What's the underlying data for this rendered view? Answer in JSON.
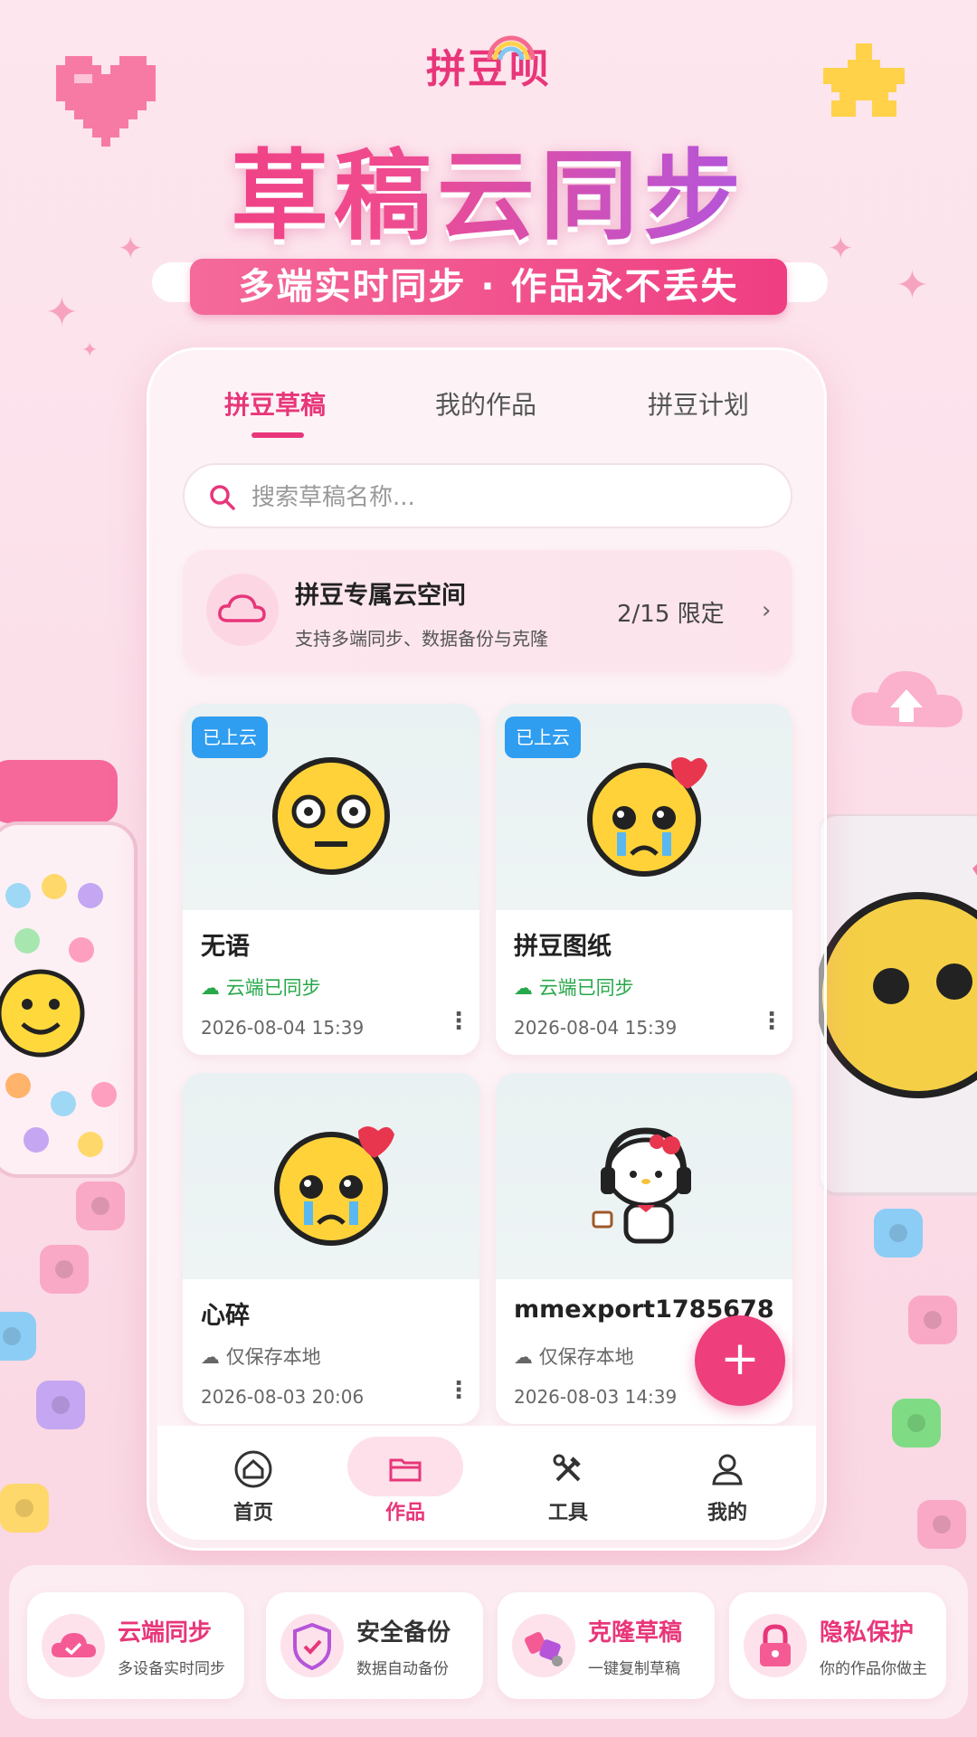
{
  "brand": "拼豆呗",
  "hero": {
    "title": "草稿云同步",
    "subtitle": "多端实时同步 · 作品永不丢失"
  },
  "tabs": [
    {
      "label": "拼豆草稿",
      "active": true
    },
    {
      "label": "我的作品",
      "active": false
    },
    {
      "label": "拼豆计划",
      "active": false
    }
  ],
  "search": {
    "placeholder": "搜索草稿名称..."
  },
  "cloud_space": {
    "title": "拼豆专属云空间",
    "description": "支持多端同步、数据备份与克隆",
    "quota": "2/15 限定",
    "chevron": "›"
  },
  "drafts": [
    {
      "name": "无语",
      "badge": "已上云",
      "status": "云端已同步",
      "synced": true,
      "date": "2026-08-04 15:39",
      "image": "speechless-face-icon"
    },
    {
      "name": "拼豆图纸",
      "badge": "已上云",
      "status": "云端已同步",
      "synced": true,
      "date": "2026-08-04 15:39",
      "image": "crying-heartbroken-face-icon"
    },
    {
      "name": "心碎",
      "badge": "",
      "status": "仅保存本地",
      "synced": false,
      "date": "2026-08-03 20:06",
      "image": "crying-heartbroken-face-icon"
    },
    {
      "name": "mmexport1785678...",
      "badge": "",
      "status": "仅保存本地",
      "synced": false,
      "date": "2026-08-03 14:39",
      "image": "kitty-headphones-icon"
    }
  ],
  "more_glyph": "⋮",
  "fab": {
    "label": "+"
  },
  "bottom_nav": [
    {
      "label": "首页",
      "icon": "home-icon",
      "active": false
    },
    {
      "label": "作品",
      "icon": "folder-icon",
      "active": true
    },
    {
      "label": "工具",
      "icon": "tools-icon",
      "active": false
    },
    {
      "label": "我的",
      "icon": "user-icon",
      "active": false
    }
  ],
  "features": [
    {
      "title": "云端同步",
      "desc": "多设备实时同步",
      "icon": "cloud-check-icon"
    },
    {
      "title": "安全备份",
      "desc": "数据自动备份",
      "icon": "shield-check-icon"
    },
    {
      "title": "克隆草稿",
      "desc": "一键复制草稿",
      "icon": "clone-icon"
    },
    {
      "title": "隐私保护",
      "desc": "你的作品你做主",
      "icon": "lock-icon"
    }
  ],
  "colors": {
    "accent": "#e8367a",
    "badge": "#2f9df0",
    "synced": "#27a84a"
  }
}
